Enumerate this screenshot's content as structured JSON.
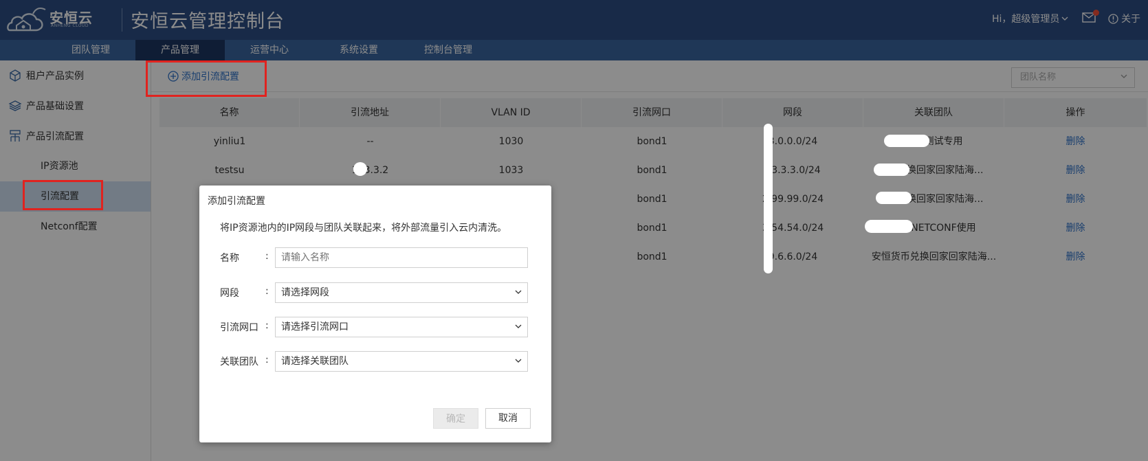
{
  "header": {
    "logo_text": "安恒云",
    "logo_sub": "ANHENG CLOUD",
    "title": "安恒云管理控制台",
    "greeting": "Hi，超级管理员",
    "about": "关于"
  },
  "nav": {
    "items": [
      "团队管理",
      "产品管理",
      "运营中心",
      "系统设置",
      "控制台管理"
    ],
    "active": "产品管理"
  },
  "sidebar": {
    "items": [
      "租户产品实例",
      "产品基础设置",
      "产品引流配置"
    ],
    "subitems": [
      "IP资源池",
      "引流配置",
      "Netconf配置"
    ],
    "active": "引流配置"
  },
  "toolbar": {
    "add_label": "添加引流配置",
    "team_placeholder": "团队名称"
  },
  "table": {
    "headers": [
      "名称",
      "引流地址",
      "VLAN ID",
      "引流网口",
      "网段",
      "关联团队",
      "操作"
    ],
    "rows": [
      [
        "yinliu1",
        "--",
        "1030",
        "bond1",
        "3.0.0.0/24",
        "引流测试专用",
        "删除"
      ],
      [
        "testsu",
        "1 .3.3.2",
        "1033",
        "bond1",
        "03.3.3.0/24",
        "安 兑换回家回家陆海...",
        "删除"
      ],
      [
        "",
        "",
        "",
        "bond1",
        "2.99.99.0/24",
        "安 兑换回家回家陆海...",
        "删除"
      ],
      [
        "",
        "",
        "",
        "bond1",
        "3.54.54.0/24",
        "测试NETCONF使用",
        "删除"
      ],
      [
        "",
        "",
        "",
        "bond1",
        "9.6.6.0/24",
        "安恒货币兑换回家回家陆海...",
        "删除"
      ]
    ]
  },
  "dialog": {
    "title": "添加引流配置",
    "description": "将IP资源池内的IP网段与团队关联起来，将外部流量引入云内清洗。",
    "fields": [
      {
        "label": "名称",
        "value": "",
        "placeholder": "请输入名称"
      },
      {
        "label": "网段",
        "value": "请选择网段"
      },
      {
        "label": "引流网口",
        "value": "请选择引流网口"
      },
      {
        "label": "关联团队",
        "value": "请选择关联团队"
      }
    ],
    "ok_label": "确定",
    "cancel_label": "取消"
  },
  "colors": {
    "header_bg": "#2d4e83",
    "nav_bg": "#39659e",
    "nav_active": "#1c3561",
    "link": "#2e72c8",
    "highlight": "#e0231f"
  }
}
